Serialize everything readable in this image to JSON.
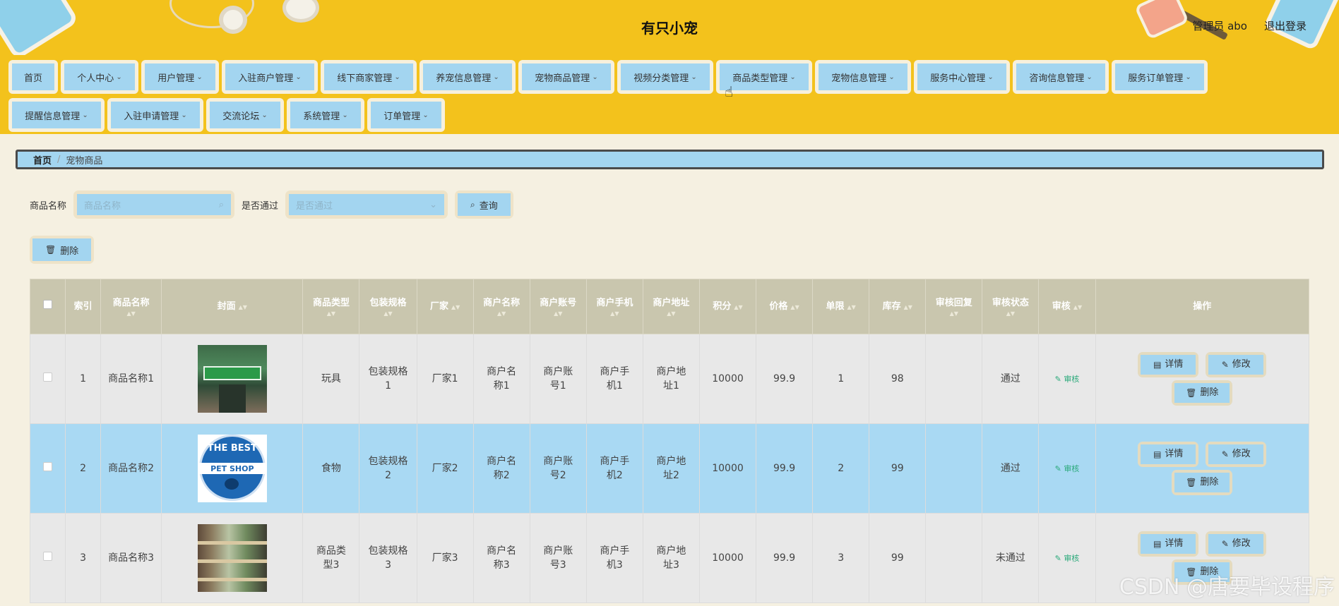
{
  "header": {
    "title": "有只小宠",
    "user_label": "管理员 abo",
    "logout_label": "退出登录"
  },
  "nav": {
    "row1": [
      {
        "label": "首页",
        "dropdown": false
      },
      {
        "label": "个人中心",
        "dropdown": true
      },
      {
        "label": "用户管理",
        "dropdown": true
      },
      {
        "label": "入驻商户管理",
        "dropdown": true
      },
      {
        "label": "线下商家管理",
        "dropdown": true
      },
      {
        "label": "养宠信息管理",
        "dropdown": true
      },
      {
        "label": "宠物商品管理",
        "dropdown": true
      },
      {
        "label": "视频分类管理",
        "dropdown": true
      },
      {
        "label": "商品类型管理",
        "dropdown": true
      },
      {
        "label": "宠物信息管理",
        "dropdown": true
      },
      {
        "label": "服务中心管理",
        "dropdown": true
      },
      {
        "label": "咨询信息管理",
        "dropdown": true
      },
      {
        "label": "服务订单管理",
        "dropdown": true
      }
    ],
    "row2": [
      {
        "label": "提醒信息管理",
        "dropdown": true
      },
      {
        "label": "入驻申请管理",
        "dropdown": true
      },
      {
        "label": "交流论坛",
        "dropdown": true
      },
      {
        "label": "系统管理",
        "dropdown": true
      },
      {
        "label": "订单管理",
        "dropdown": true
      }
    ]
  },
  "breadcrumb": {
    "home": "首页",
    "separator": "/",
    "current": "宠物商品"
  },
  "search": {
    "name_label": "商品名称",
    "name_placeholder": "商品名称",
    "pass_label": "是否通过",
    "pass_placeholder": "是否通过",
    "query_label": "查询"
  },
  "toolbar": {
    "delete_label": "删除"
  },
  "table": {
    "headers": [
      "索引",
      "商品名称",
      "封面",
      "商品类型",
      "包装规格",
      "厂家",
      "商户名称",
      "商户账号",
      "商户手机",
      "商户地址",
      "积分",
      "价格",
      "单限",
      "库存",
      "审核回复",
      "审核状态",
      "审核",
      "操作"
    ],
    "rows": [
      {
        "index": "1",
        "name": "商品名称1",
        "type": "玩具",
        "spec": "包装规格1",
        "maker": "厂家1",
        "merchant": "商户名称1",
        "account": "商户账号1",
        "phone": "商户手机1",
        "address": "商户地址1",
        "points": "10000",
        "price": "99.9",
        "limit": "1",
        "stock": "98",
        "reply": "",
        "status": "通过",
        "audit": "审核"
      },
      {
        "index": "2",
        "name": "商品名称2",
        "type": "食物",
        "spec": "包装规格2",
        "maker": "厂家2",
        "merchant": "商户名称2",
        "account": "商户账号2",
        "phone": "商户手机2",
        "address": "商户地址2",
        "points": "10000",
        "price": "99.9",
        "limit": "2",
        "stock": "99",
        "reply": "",
        "status": "通过",
        "audit": "审核"
      },
      {
        "index": "3",
        "name": "商品名称3",
        "type": "商品类型3",
        "spec": "包装规格3",
        "maker": "厂家3",
        "merchant": "商户名称3",
        "account": "商户账号3",
        "phone": "商户手机3",
        "address": "商户地址3",
        "points": "10000",
        "price": "99.9",
        "limit": "3",
        "stock": "99",
        "reply": "",
        "status": "未通过",
        "audit": "审核"
      }
    ],
    "ops": {
      "detail": "详情",
      "edit": "修改",
      "delete": "删除"
    },
    "cover_texts": {
      "best": "THE BEST",
      "petshop": "PET SHOP"
    }
  },
  "watermark": "CSDN @唐要毕设程序",
  "colors": {
    "header_bg": "#f3c21c",
    "button_bg": "#a3d5f0",
    "page_bg": "#f5f0e1",
    "table_header_bg": "#c9c6ae",
    "selected_row_bg": "#a9d9f3",
    "audit_green": "#2aa97a"
  }
}
